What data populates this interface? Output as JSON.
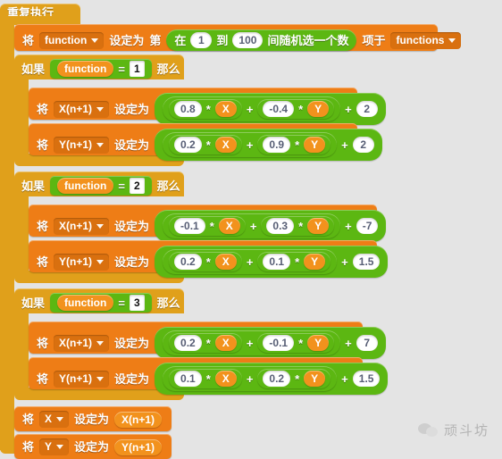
{
  "canvas": {
    "background_color": "#e4e4e4",
    "palette": {
      "control_yellow": "#e0a01b",
      "data_orange": "#ee7d16",
      "operator_green": "#5cb712",
      "variable_orange": "#f2921d",
      "input_white": "#ffffff"
    }
  },
  "script": {
    "repeat_block": {
      "label": "重复执行"
    },
    "set_function": {
      "set_label": "将",
      "variable": "function",
      "to_label": "设定为",
      "item_label": "第",
      "of_label": "项于",
      "list_name": "functions",
      "random": {
        "pick_label": "在",
        "from": "1",
        "to_word": "到",
        "to": "100",
        "suffix_label": "间随机选一个数"
      }
    },
    "branches": [
      {
        "if_label": "如果",
        "then_label": "那么",
        "condition": {
          "variable": "function",
          "operator": "=",
          "value": "1"
        },
        "statements": [
          {
            "set_label": "将",
            "variable": "X(n+1)",
            "to_label": "设定为",
            "expr": {
              "a": "0.8",
              "mul": "*",
              "xvar": "X",
              "plus1": "+",
              "b": "-0.4",
              "mul2": "*",
              "yvar": "Y",
              "plus2": "+",
              "c": "2"
            }
          },
          {
            "set_label": "将",
            "variable": "Y(n+1)",
            "to_label": "设定为",
            "expr": {
              "a": "0.2",
              "mul": "*",
              "xvar": "X",
              "plus1": "+",
              "b": "0.9",
              "mul2": "*",
              "yvar": "Y",
              "plus2": "+",
              "c": "2"
            }
          }
        ]
      },
      {
        "if_label": "如果",
        "then_label": "那么",
        "condition": {
          "variable": "function",
          "operator": "=",
          "value": "2"
        },
        "statements": [
          {
            "set_label": "将",
            "variable": "X(n+1)",
            "to_label": "设定为",
            "expr": {
              "a": "-0.1",
              "mul": "*",
              "xvar": "X",
              "plus1": "+",
              "b": "0.3",
              "mul2": "*",
              "yvar": "Y",
              "plus2": "+",
              "c": "-7"
            }
          },
          {
            "set_label": "将",
            "variable": "Y(n+1)",
            "to_label": "设定为",
            "expr": {
              "a": "0.2",
              "mul": "*",
              "xvar": "X",
              "plus1": "+",
              "b": "0.1",
              "mul2": "*",
              "yvar": "Y",
              "plus2": "+",
              "c": "1.5"
            }
          }
        ]
      },
      {
        "if_label": "如果",
        "then_label": "那么",
        "condition": {
          "variable": "function",
          "operator": "=",
          "value": "3"
        },
        "statements": [
          {
            "set_label": "将",
            "variable": "X(n+1)",
            "to_label": "设定为",
            "expr": {
              "a": "0.2",
              "mul": "*",
              "xvar": "X",
              "plus1": "+",
              "b": "-0.1",
              "mul2": "*",
              "yvar": "Y",
              "plus2": "+",
              "c": "7"
            }
          },
          {
            "set_label": "将",
            "variable": "Y(n+1)",
            "to_label": "设定为",
            "expr": {
              "a": "0.1",
              "mul": "*",
              "xvar": "X",
              "plus1": "+",
              "b": "0.2",
              "mul2": "*",
              "yvar": "Y",
              "plus2": "+",
              "c": "1.5"
            }
          }
        ]
      }
    ],
    "tail": [
      {
        "set_label": "将",
        "variable": "X",
        "to_label": "设定为",
        "value": "X(n+1)"
      },
      {
        "set_label": "将",
        "variable": "Y",
        "to_label": "设定为",
        "value": "Y(n+1)"
      }
    ]
  },
  "watermark": {
    "text": "顽斗坊",
    "icon": "wechat-icon"
  }
}
